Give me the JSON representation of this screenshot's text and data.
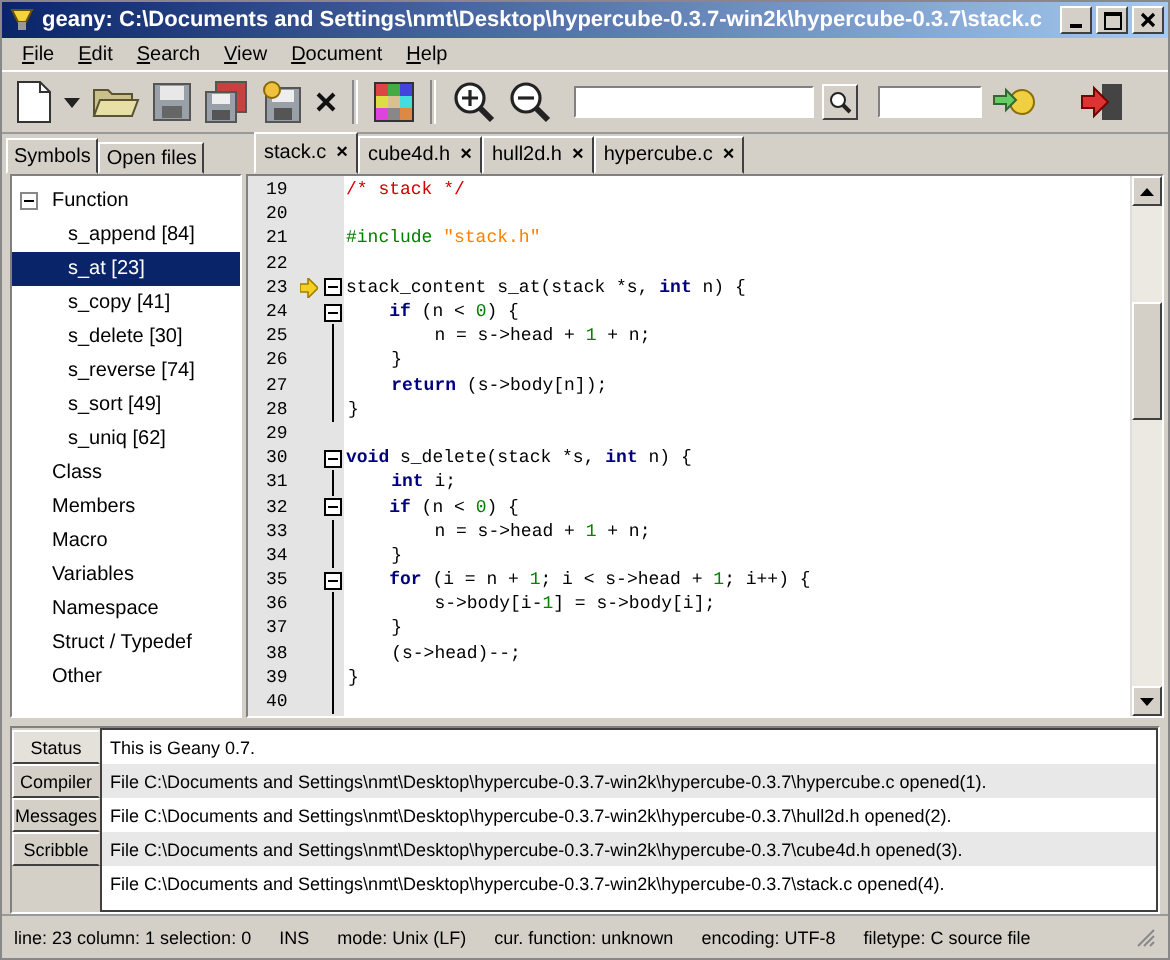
{
  "window": {
    "title": "geany: C:\\Documents and Settings\\nmt\\Desktop\\hypercube-0.3.7-win2k\\hypercube-0.3.7\\stack.c"
  },
  "menu": [
    "File",
    "Edit",
    "Search",
    "View",
    "Document",
    "Help"
  ],
  "toolbar": [
    {
      "kind": "new"
    },
    {
      "kind": "dropdown"
    },
    {
      "kind": "open"
    },
    {
      "kind": "save"
    },
    {
      "kind": "save-all"
    },
    {
      "kind": "revert"
    },
    {
      "kind": "close"
    },
    {
      "kind": "separator"
    },
    {
      "kind": "color"
    },
    {
      "kind": "separator"
    },
    {
      "kind": "zoom-in"
    },
    {
      "kind": "zoom-out"
    },
    {
      "kind": "search-field"
    },
    {
      "kind": "find"
    },
    {
      "kind": "goto-field"
    },
    {
      "kind": "goto"
    },
    {
      "kind": "quit"
    }
  ],
  "sidebar": {
    "tabs": [
      {
        "label": "Symbols",
        "selected": true
      },
      {
        "label": "Open files",
        "selected": false
      }
    ],
    "symbols": [
      {
        "label": "Function",
        "expanded": true,
        "selected": false,
        "children": [
          {
            "label": "s_append [84]",
            "selected": false
          },
          {
            "label": "s_at [23]",
            "selected": true
          },
          {
            "label": "s_copy [41]",
            "selected": false
          },
          {
            "label": "s_delete [30]",
            "selected": false
          },
          {
            "label": "s_reverse [74]",
            "selected": false
          },
          {
            "label": "s_sort [49]",
            "selected": false
          },
          {
            "label": "s_uniq [62]",
            "selected": false
          }
        ]
      },
      {
        "label": "Class",
        "selected": false
      },
      {
        "label": "Members",
        "selected": false
      },
      {
        "label": "Macro",
        "selected": false
      },
      {
        "label": "Variables",
        "selected": false
      },
      {
        "label": "Namespace",
        "selected": false
      },
      {
        "label": "Struct / Typedef",
        "selected": false
      },
      {
        "label": "Other",
        "selected": false
      }
    ]
  },
  "editor": {
    "tabs": [
      {
        "label": "stack.c",
        "close": "×",
        "selected": true
      },
      {
        "label": "cube4d.h",
        "close": "×",
        "selected": false
      },
      {
        "label": "hull2d.h",
        "close": "×",
        "selected": false
      },
      {
        "label": "hypercube.c",
        "close": "×",
        "selected": false
      }
    ],
    "lines": [
      {
        "number": "19",
        "kind": "plain",
        "marker": false,
        "code": [
          {
            "t": "/* stack */",
            "kind": "comment"
          }
        ]
      },
      {
        "number": "20",
        "kind": "plain",
        "marker": false
      },
      {
        "number": "21",
        "kind": "plain",
        "marker": false,
        "code": [
          {
            "t": "#include ",
            "kind": "preproc"
          },
          {
            "t": "\"stack.h\"",
            "kind": "string"
          }
        ]
      },
      {
        "number": "22",
        "kind": "plain",
        "marker": false
      },
      {
        "number": "23",
        "kind": "fold-start",
        "marker": true,
        "code": [
          {
            "t": "stack_content s_at(stack *s, ",
            "kind": "plain"
          },
          {
            "t": "int",
            "kind": "keyword"
          },
          {
            "t": " n) {",
            "kind": "plain"
          }
        ]
      },
      {
        "number": "24",
        "kind": "fold-start",
        "marker": false,
        "code": [
          {
            "t": "    if",
            "kind": "keyword"
          },
          {
            "t": " (n < ",
            "kind": "plain"
          },
          {
            "t": "0",
            "kind": "number"
          },
          {
            "t": ") {",
            "kind": "plain"
          }
        ]
      },
      {
        "number": "25",
        "kind": "fold-body",
        "marker": false,
        "code": [
          {
            "t": "        n = s->head + ",
            "kind": "plain"
          },
          {
            "t": "1",
            "kind": "number"
          },
          {
            "t": " + n;",
            "kind": "plain"
          }
        ]
      },
      {
        "number": "26",
        "kind": "fold-end",
        "marker": false,
        "code": [
          {
            "t": "    }",
            "kind": "plain"
          }
        ]
      },
      {
        "number": "27",
        "kind": "fold-body",
        "marker": false,
        "code": [
          {
            "t": "    return",
            "kind": "keyword"
          },
          {
            "t": " (s->body[n]);",
            "kind": "plain"
          }
        ]
      },
      {
        "number": "28",
        "kind": "fold-end",
        "marker": false,
        "code": [
          {
            "t": "}",
            "kind": "plain"
          }
        ]
      },
      {
        "number": "29",
        "kind": "plain",
        "marker": false
      },
      {
        "number": "30",
        "kind": "fold-start",
        "marker": false,
        "code": [
          {
            "t": "void",
            "kind": "keyword"
          },
          {
            "t": " s_delete(stack *s, ",
            "kind": "plain"
          },
          {
            "t": "int",
            "kind": "keyword"
          },
          {
            "t": " n) {",
            "kind": "plain"
          }
        ]
      },
      {
        "number": "31",
        "kind": "fold-body",
        "marker": false,
        "code": [
          {
            "t": "    int",
            "kind": "keyword"
          },
          {
            "t": " i;",
            "kind": "plain"
          }
        ]
      },
      {
        "number": "32",
        "kind": "fold-start",
        "marker": false,
        "code": [
          {
            "t": "    if",
            "kind": "keyword"
          },
          {
            "t": " (n < ",
            "kind": "plain"
          },
          {
            "t": "0",
            "kind": "number"
          },
          {
            "t": ") {",
            "kind": "plain"
          }
        ]
      },
      {
        "number": "33",
        "kind": "fold-body",
        "marker": false,
        "code": [
          {
            "t": "        n = s->head + ",
            "kind": "plain"
          },
          {
            "t": "1",
            "kind": "number"
          },
          {
            "t": " + n;",
            "kind": "plain"
          }
        ]
      },
      {
        "number": "34",
        "kind": "fold-end",
        "marker": false,
        "code": [
          {
            "t": "    }",
            "kind": "plain"
          }
        ]
      },
      {
        "number": "35",
        "kind": "fold-start",
        "marker": false,
        "code": [
          {
            "t": "    for",
            "kind": "keyword"
          },
          {
            "t": " (i = n + ",
            "kind": "plain"
          },
          {
            "t": "1",
            "kind": "number"
          },
          {
            "t": "; i < s->head + ",
            "kind": "plain"
          },
          {
            "t": "1",
            "kind": "number"
          },
          {
            "t": "; i++) {",
            "kind": "plain"
          }
        ]
      },
      {
        "number": "36",
        "kind": "fold-body",
        "marker": false,
        "code": [
          {
            "t": "        s->body[i-",
            "kind": "plain"
          },
          {
            "t": "1",
            "kind": "number"
          },
          {
            "t": "] = s->body[i];",
            "kind": "plain"
          }
        ]
      },
      {
        "number": "37",
        "kind": "fold-end",
        "marker": false,
        "code": [
          {
            "t": "    }",
            "kind": "plain"
          }
        ]
      },
      {
        "number": "38",
        "kind": "fold-body",
        "marker": false,
        "code": [
          {
            "t": "    (s->head)--;",
            "kind": "plain"
          }
        ]
      },
      {
        "number": "39",
        "kind": "fold-end",
        "marker": false,
        "code": [
          {
            "t": "}",
            "kind": "plain"
          }
        ]
      },
      {
        "number": "40",
        "kind": "fold-end",
        "marker": false
      }
    ]
  },
  "messages": {
    "tabs": [
      {
        "label": "Status",
        "selected": true
      },
      {
        "label": "Compiler",
        "selected": false
      },
      {
        "label": "Messages",
        "selected": false
      },
      {
        "label": "Scribble",
        "selected": false
      }
    ],
    "lines": [
      "This is Geany 0.7.",
      "File C:\\Documents and Settings\\nmt\\Desktop\\hypercube-0.3.7-win2k\\hypercube-0.3.7\\hypercube.c opened(1).",
      "File C:\\Documents and Settings\\nmt\\Desktop\\hypercube-0.3.7-win2k\\hypercube-0.3.7\\hull2d.h opened(2).",
      "File C:\\Documents and Settings\\nmt\\Desktop\\hypercube-0.3.7-win2k\\hypercube-0.3.7\\cube4d.h opened(3).",
      "File C:\\Documents and Settings\\nmt\\Desktop\\hypercube-0.3.7-win2k\\hypercube-0.3.7\\stack.c opened(4)."
    ]
  },
  "status_bar": [
    "line:  23 column:  1 selection:  0",
    "INS",
    "mode: Unix (LF)",
    "cur. function: unknown",
    "encoding: UTF-8",
    "filetype: C source file"
  ]
}
